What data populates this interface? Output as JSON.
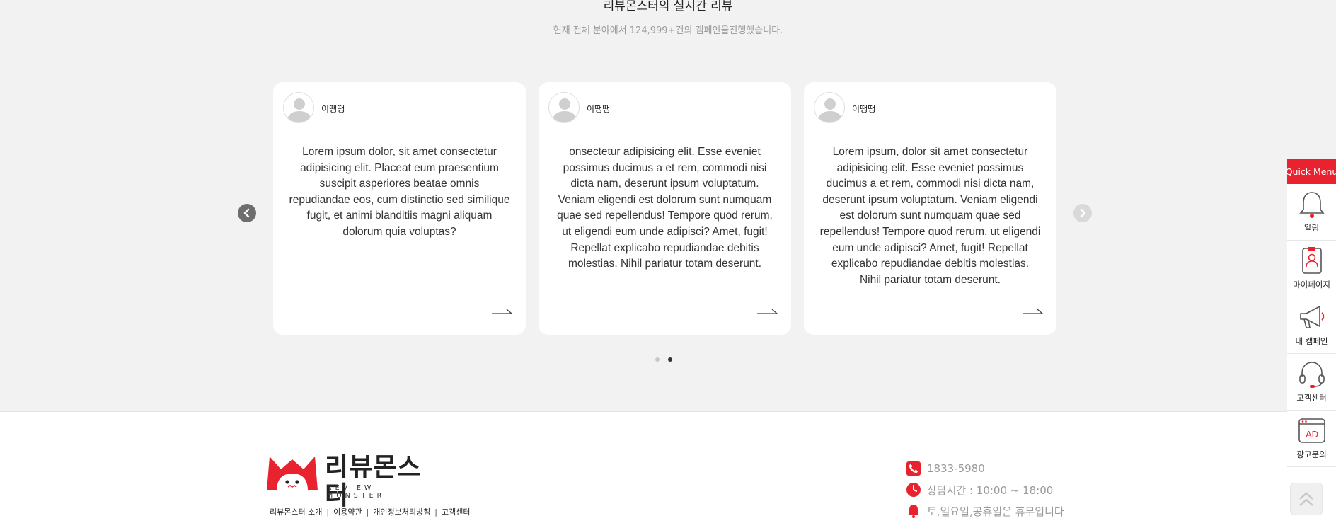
{
  "section": {
    "title": "리뷰몬스터의 실시간 리뷰",
    "subtitle": "현재 전체 분야에서 124,999+건의 캠페인을진행했습니다."
  },
  "reviews": [
    {
      "name": "이땡땡",
      "text": "Lorem ipsum dolor, sit amet consectetur adipisicing elit. Placeat eum praesentium suscipit asperiores beatae omnis repudiandae eos, cum distinctio sed similique fugit, et animi blanditiis magni aliquam dolorum quia voluptas?"
    },
    {
      "name": "이땡땡",
      "text": "onsectetur adipisicing elit. Esse eveniet possimus ducimus a et rem, commodi nisi dicta nam, deserunt ipsum voluptatum. Veniam eligendi est dolorum sunt numquam quae sed repellendus! Tempore quod rerum, ut eligendi eum unde adipisci? Amet, fugit! Repellat explicabo repudiandae debitis molestias. Nihil pariatur totam deserunt."
    },
    {
      "name": "이땡땡",
      "text": "Lorem ipsum, dolor sit amet consectetur adipisicing elit. Esse eveniet possimus ducimus a et rem, commodi nisi dicta nam, deserunt ipsum voluptatum. Veniam eligendi est dolorum sunt numquam quae sed repellendus! Tempore quod rerum, ut eligendi eum unde adipisci? Amet, fugit! Repellat explicabo repudiandae debitis molestias. Nihil pariatur totam deserunt."
    }
  ],
  "pagination": {
    "total": 2,
    "active": 2
  },
  "footer": {
    "logo_name": "리뷰몬스터",
    "logo_sub": "REVIEW MONSTER",
    "links": [
      "리뷰몬스터 소개",
      "이용약관",
      "개인정보처리방침",
      "고객센터"
    ],
    "phone": "1833-5980",
    "hours": "상담시간 : 10:00 ~ 18:00",
    "holiday": "토,일요일,공휴일은 휴무입니다"
  },
  "quick_menu": {
    "title": "Quick Menu",
    "items": [
      {
        "label": "알림",
        "icon": "bell-icon"
      },
      {
        "label": "마이페이지",
        "icon": "mypage-icon"
      },
      {
        "label": "내 캠페인",
        "icon": "megaphone-icon"
      },
      {
        "label": "고객센터",
        "icon": "headset-icon"
      },
      {
        "label": "광고문의",
        "icon": "ad-icon"
      }
    ]
  },
  "colors": {
    "accent": "#e8222e",
    "background": "#f2f2f2"
  }
}
